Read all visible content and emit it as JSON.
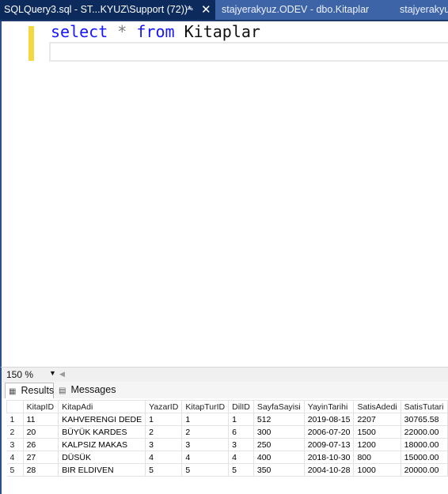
{
  "tabs": {
    "active_title": "SQLQuery3.sql - ST...KYUZ\\Support (72))*",
    "pin_glyph": "⊸",
    "close_glyph": "✕",
    "second_title": "stajyerakyuz.ODEV - dbo.Kitaplar",
    "third_title": "stajyerakyuz"
  },
  "editor": {
    "keyword_select": "select",
    "star": "*",
    "keyword_from": "from",
    "table_name": "Kitaplar"
  },
  "status": {
    "zoom": "150 %"
  },
  "results_tabs": {
    "results_label": "Results",
    "messages_label": "Messages"
  },
  "grid": {
    "columns": [
      "",
      "KitapID",
      "KitapAdi",
      "YazarID",
      "KitapTurID",
      "DilID",
      "SayfaSayisi",
      "YayinTarihi",
      "SatisAdedi",
      "SatisTutari"
    ],
    "rows": [
      [
        "1",
        "11",
        "KAHVERENGI DEDE",
        "1",
        "1",
        "1",
        "512",
        "2019-08-15",
        "2207",
        "30765.58"
      ],
      [
        "2",
        "20",
        "BÜYÜK KARDES",
        "2",
        "2",
        "6",
        "300",
        "2006-07-20",
        "1500",
        "22000.00"
      ],
      [
        "3",
        "26",
        "KALPSIZ MAKAS",
        "3",
        "3",
        "3",
        "250",
        "2009-07-13",
        "1200",
        "18000.00"
      ],
      [
        "4",
        "27",
        "DÜSÜK",
        "4",
        "4",
        "4",
        "400",
        "2018-10-30",
        "800",
        "15000.00"
      ],
      [
        "5",
        "28",
        "BIR ELDIVEN",
        "5",
        "5",
        "5",
        "350",
        "2004-10-28",
        "1000",
        "20000.00"
      ]
    ]
  }
}
